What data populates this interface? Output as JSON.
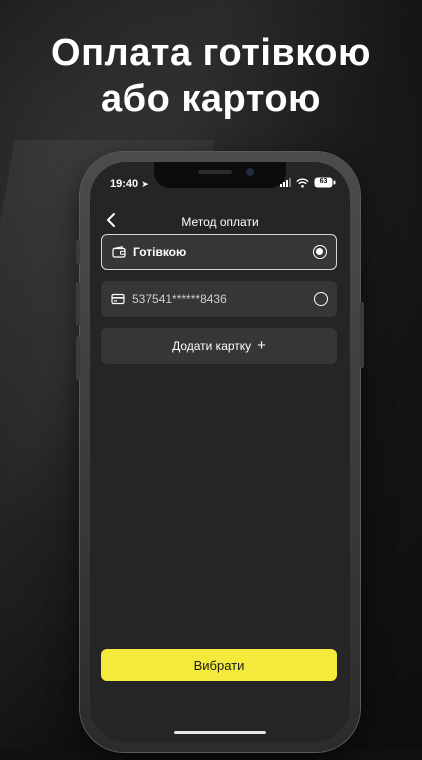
{
  "headline": {
    "line1": "Оплата готівкою",
    "line2": "або картою"
  },
  "status_bar": {
    "time": "19:40",
    "battery": "63"
  },
  "header": {
    "title": "Метод оплати"
  },
  "payment_options": [
    {
      "label": "Готівкою",
      "icon": "wallet-icon",
      "selected": true
    },
    {
      "label": "537541******8436",
      "icon": "credit-card-icon",
      "selected": false
    }
  ],
  "add_card": {
    "label": "Додати картку",
    "icon": "plus-icon"
  },
  "submit": {
    "label": "Вибрати"
  },
  "colors": {
    "accent": "#f3ea3c",
    "screen_bg": "#252525",
    "card_bg": "#363636"
  }
}
